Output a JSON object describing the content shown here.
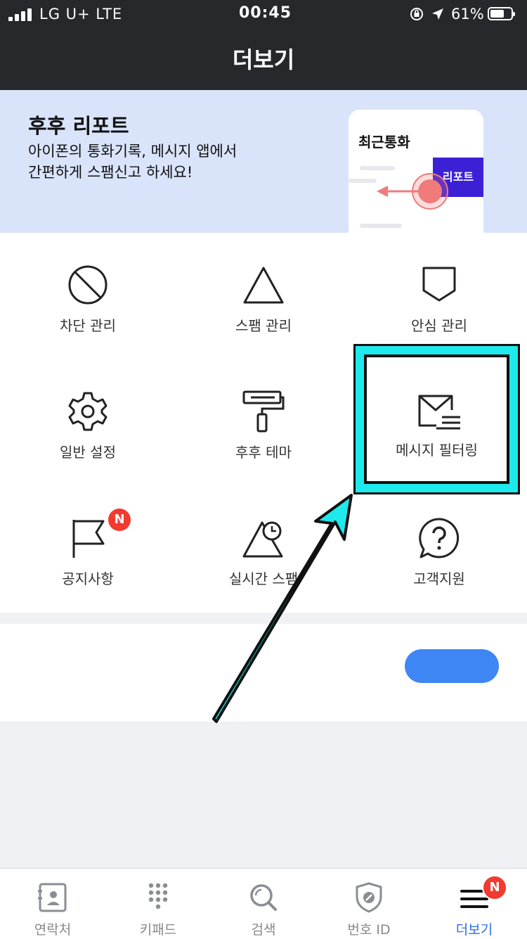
{
  "status_bar": {
    "carrier": "LG U+  LTE",
    "time": "00:45",
    "battery": "61%"
  },
  "header": {
    "title": "더보기"
  },
  "banner": {
    "title": "후후 리포트",
    "desc_line1": "아이폰의 통화기록, 메시지 앱에서",
    "desc_line2": "간편하게 스팸신고 하세요!",
    "card_title": "최근통화",
    "card_tag": "리포트"
  },
  "menu": [
    {
      "label": "차단 관리",
      "icon": "block-icon"
    },
    {
      "label": "스팸 관리",
      "icon": "triangle-icon"
    },
    {
      "label": "안심 관리",
      "icon": "shield-icon"
    },
    {
      "label": "일반 설정",
      "icon": "gear-icon"
    },
    {
      "label": "후후 테마",
      "icon": "paint-roller-icon"
    },
    {
      "label": "메시지 필터링",
      "icon": "mail-filter-icon"
    },
    {
      "label": "공지사항",
      "icon": "flag-icon",
      "badge": "N"
    },
    {
      "label": "실시간 스팸",
      "icon": "clock-triangle-icon"
    },
    {
      "label": "고객지원",
      "icon": "help-icon"
    }
  ],
  "tabs": [
    {
      "label": "연락처",
      "icon": "contacts-icon"
    },
    {
      "label": "키패드",
      "icon": "keypad-icon"
    },
    {
      "label": "검색",
      "icon": "search-icon"
    },
    {
      "label": "번호 ID",
      "icon": "number-id-icon"
    },
    {
      "label": "더보기",
      "icon": "menu-icon",
      "badge": "N",
      "active": true
    }
  ],
  "colors": {
    "header_bg": "#27282c",
    "banner_bg": "#d9e4fa",
    "accent_blue": "#3f86f5",
    "tab_active": "#2f6fe6",
    "badge_red": "#f23a2f",
    "highlight_cyan": "#1ee9ec"
  }
}
